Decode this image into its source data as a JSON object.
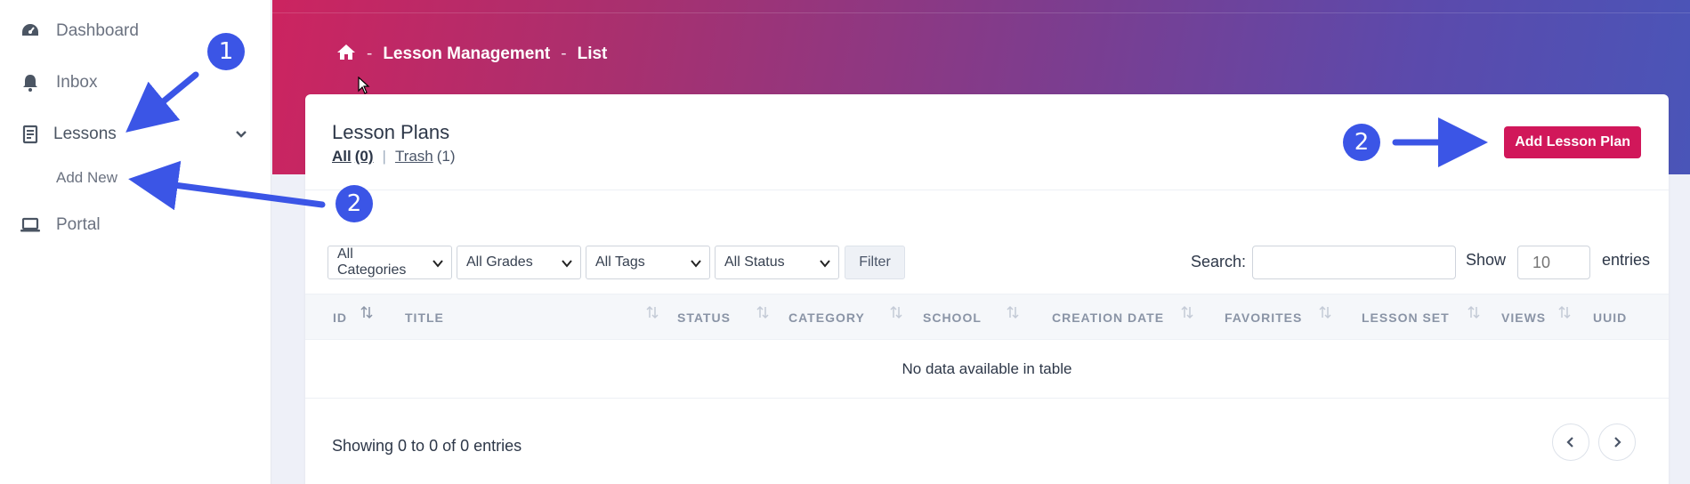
{
  "sidebar": {
    "items": [
      {
        "label": "Dashboard",
        "icon": "dashboard-icon"
      },
      {
        "label": "Inbox",
        "icon": "bell-icon"
      },
      {
        "label": "Lessons",
        "icon": "document-icon"
      },
      {
        "label": "Portal",
        "icon": "laptop-icon"
      }
    ],
    "sub_items": [
      {
        "label": "Add New"
      }
    ]
  },
  "breadcrumb": {
    "home_icon": "home-icon",
    "separator": "-",
    "items": [
      "Lesson Management",
      "List"
    ]
  },
  "card": {
    "title": "Lesson Plans",
    "tabs": {
      "all_label": "All",
      "all_count": "(0)",
      "divider": "|",
      "trash_label": "Trash",
      "trash_count": "(1)"
    },
    "add_button": "Add Lesson Plan"
  },
  "filters": {
    "categories": "All Categories",
    "grades": "All Grades",
    "tags": "All Tags",
    "status": "All Status",
    "filter_button": "Filter",
    "search_label": "Search:",
    "show_label": "Show",
    "show_value": "10",
    "entries_label": "entries"
  },
  "table": {
    "columns": [
      "ID",
      "TITLE",
      "STATUS",
      "CATEGORY",
      "SCHOOL",
      "CREATION DATE",
      "FAVORITES",
      "LESSON SET",
      "VIEWS",
      "UUID"
    ],
    "empty_message": "No data available in table",
    "showing": "Showing 0 to 0 of 0 entries"
  },
  "annotations": [
    "1",
    "2",
    "2"
  ],
  "colors": {
    "primary": "#d1175a",
    "annotation": "#3b55e6",
    "header_start": "#cc2460",
    "header_end": "#4a55b8"
  }
}
